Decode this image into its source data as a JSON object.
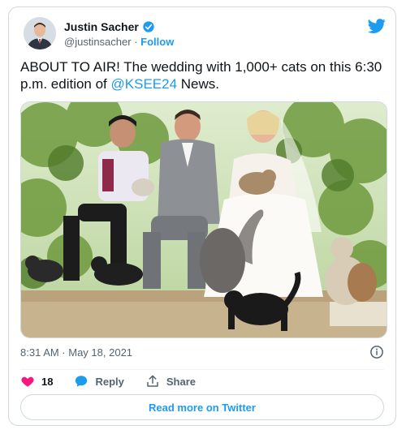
{
  "author": {
    "name": "Justin Sacher",
    "handle": "@justinsacher",
    "separator": "·",
    "follow_label": "Follow",
    "verified_icon": "verified-badge-icon",
    "brand_icon": "twitter-bird-icon"
  },
  "tweet": {
    "text_before": "ABOUT TO AIR!  The wedding with 1,000+ cats on this 6:30 p.m. edition of ",
    "mention": "@KSEE24",
    "text_after": " News."
  },
  "timestamp": "8:31 AM · May 18, 2021",
  "actions": {
    "like_count": "18",
    "reply_label": "Reply",
    "share_label": "Share"
  },
  "read_more_label": "Read more on Twitter",
  "colors": {
    "accent": "#1d9bf0",
    "like": "#f91880",
    "text": "#0f1419",
    "muted": "#536471",
    "border": "#cfd9de"
  }
}
